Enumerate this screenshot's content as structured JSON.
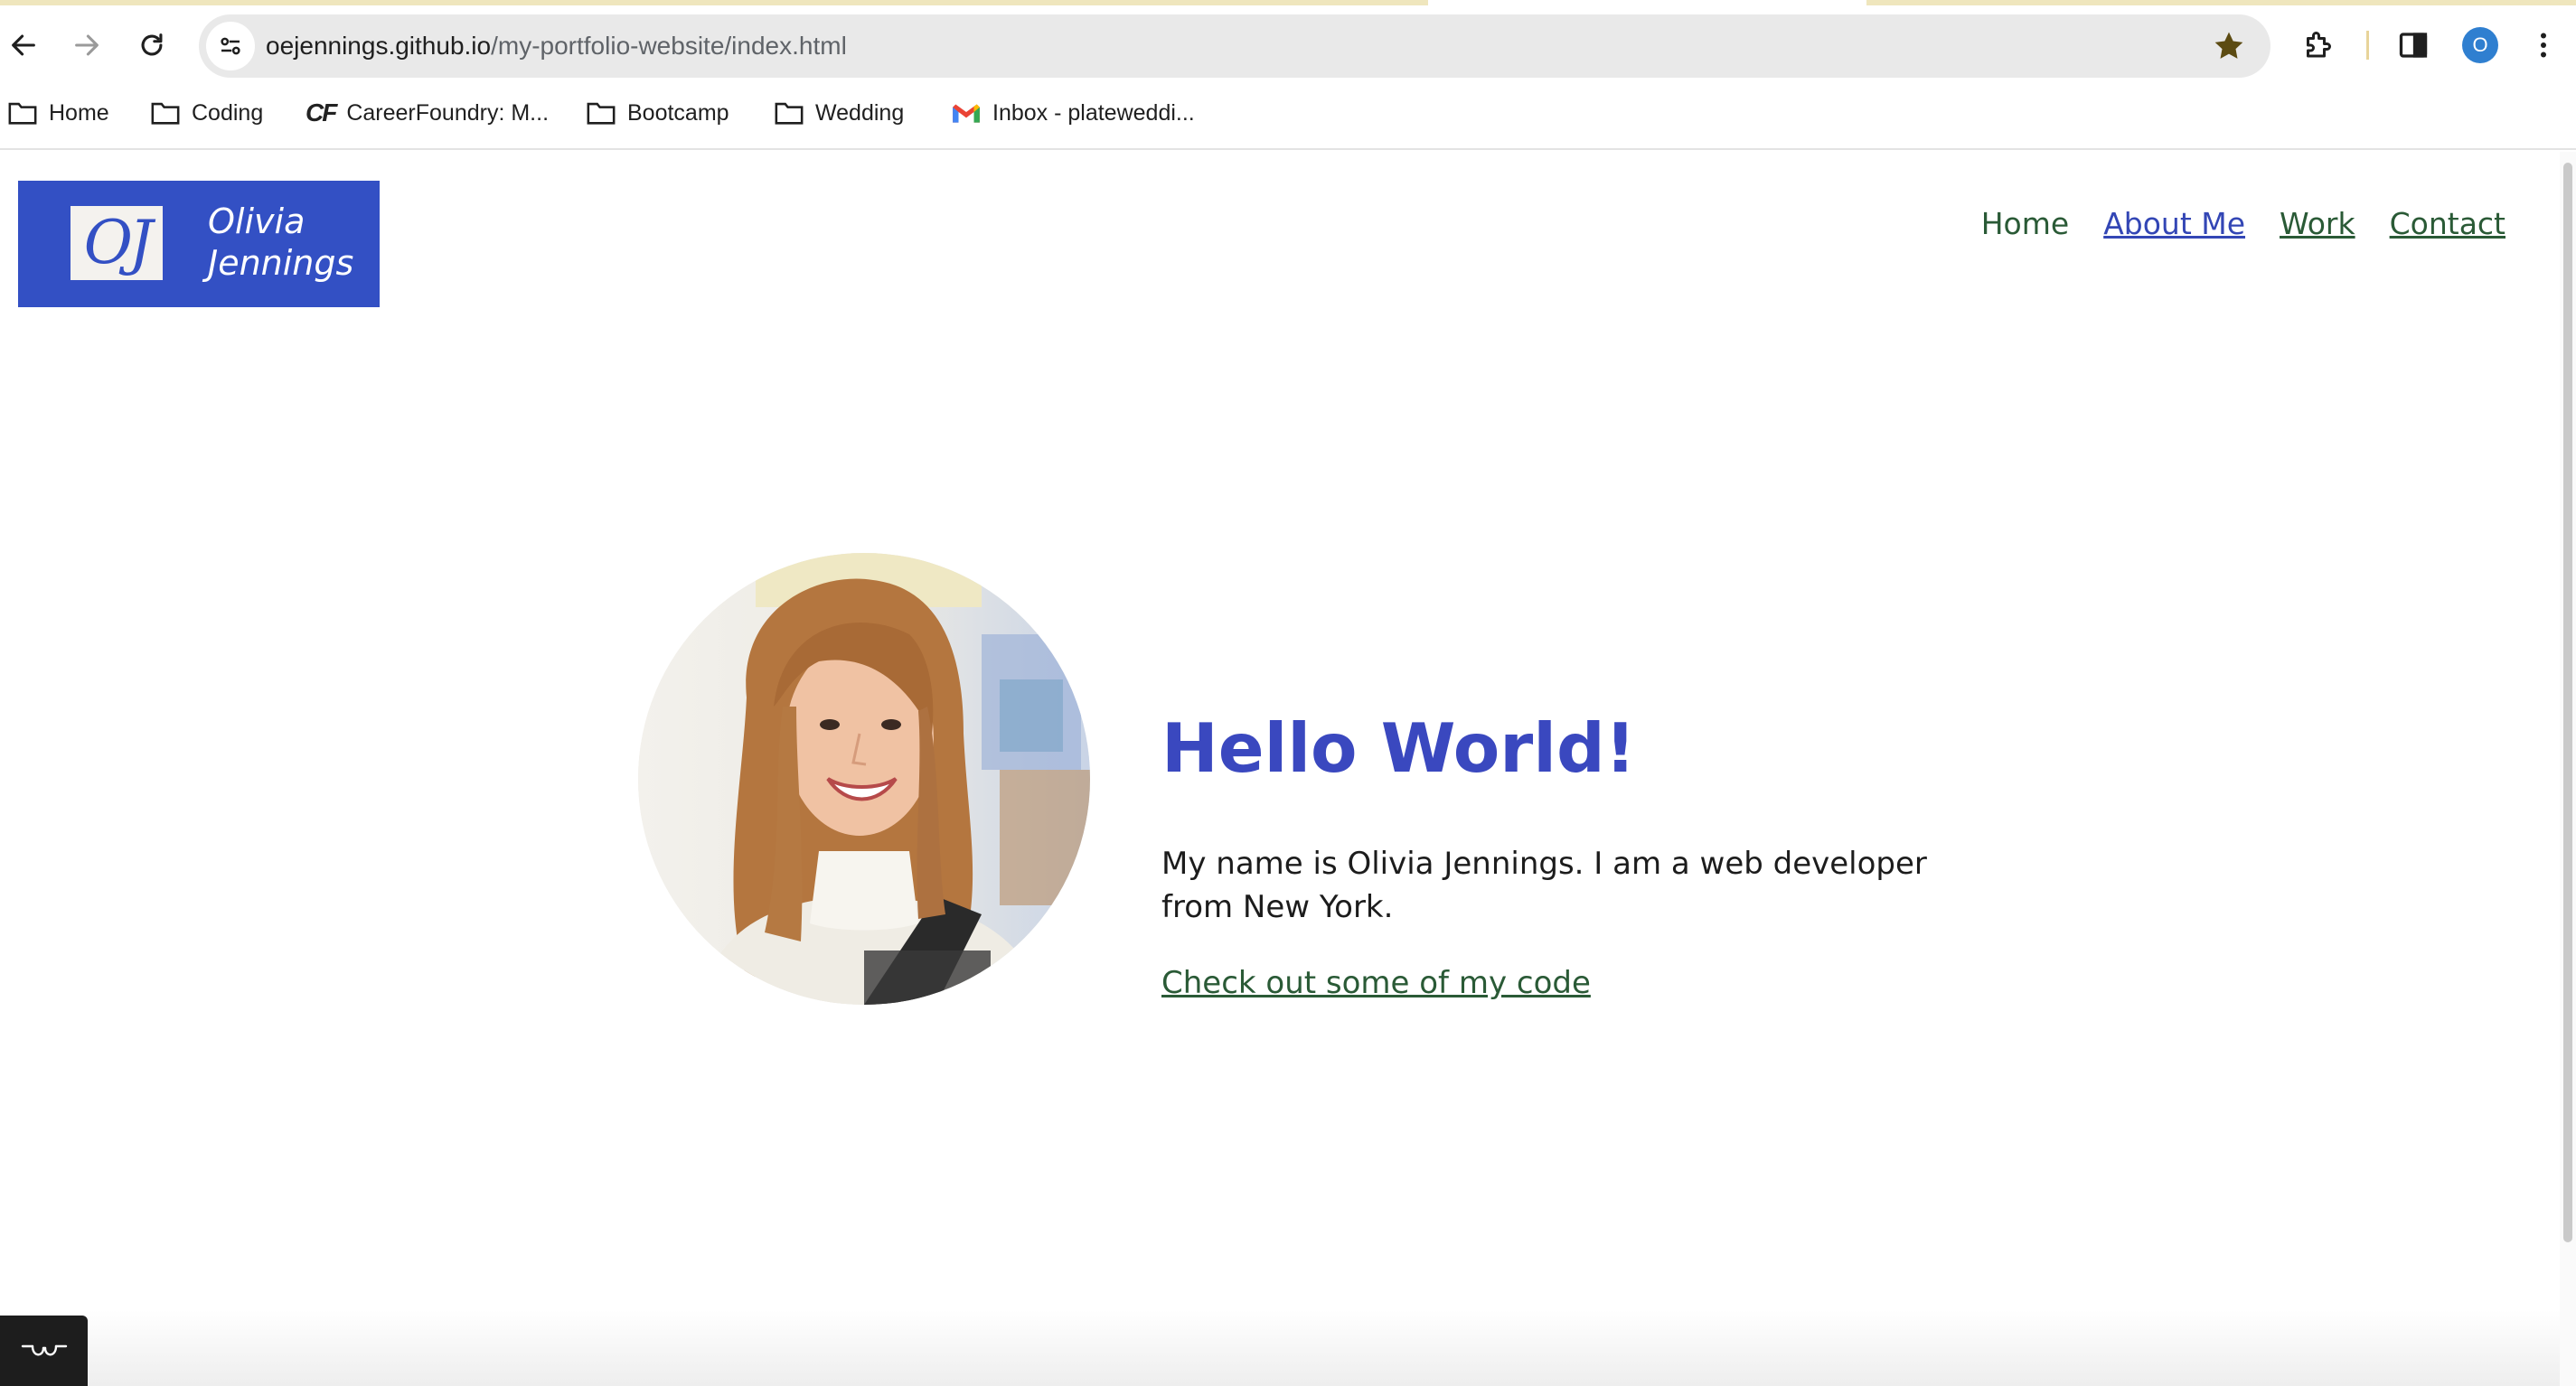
{
  "browser": {
    "url_domain": "oejennings.github.io",
    "url_path": "/my-portfolio-website/index.html",
    "profile_initial": "O",
    "bookmarks": [
      {
        "label": "Home",
        "icon": "folder-icon"
      },
      {
        "label": "Coding",
        "icon": "folder-icon"
      },
      {
        "label": "CareerFoundry: M...",
        "icon": "careerfoundry-icon"
      },
      {
        "label": "Bootcamp",
        "icon": "folder-icon"
      },
      {
        "label": "Wedding",
        "icon": "folder-icon"
      },
      {
        "label": "Inbox - plateweddi...",
        "icon": "gmail-icon"
      }
    ],
    "bookmark_logo_cf": "CF"
  },
  "site": {
    "logo_mark": "OJ",
    "logo_first": "Olivia",
    "logo_last": "Jennings",
    "nav": [
      {
        "label": "Home"
      },
      {
        "label": "About Me"
      },
      {
        "label": "Work"
      },
      {
        "label": "Contact"
      }
    ],
    "hero_title": "Hello World!",
    "hero_text": "My name is Olivia Jennings. I am a web developer from New York.",
    "hero_link": "Check out some of my code"
  },
  "colors": {
    "logo_bg": "#3350c4",
    "heading": "#3a48bf",
    "link_green": "#2a5a36",
    "link_visited": "#3346b5"
  }
}
